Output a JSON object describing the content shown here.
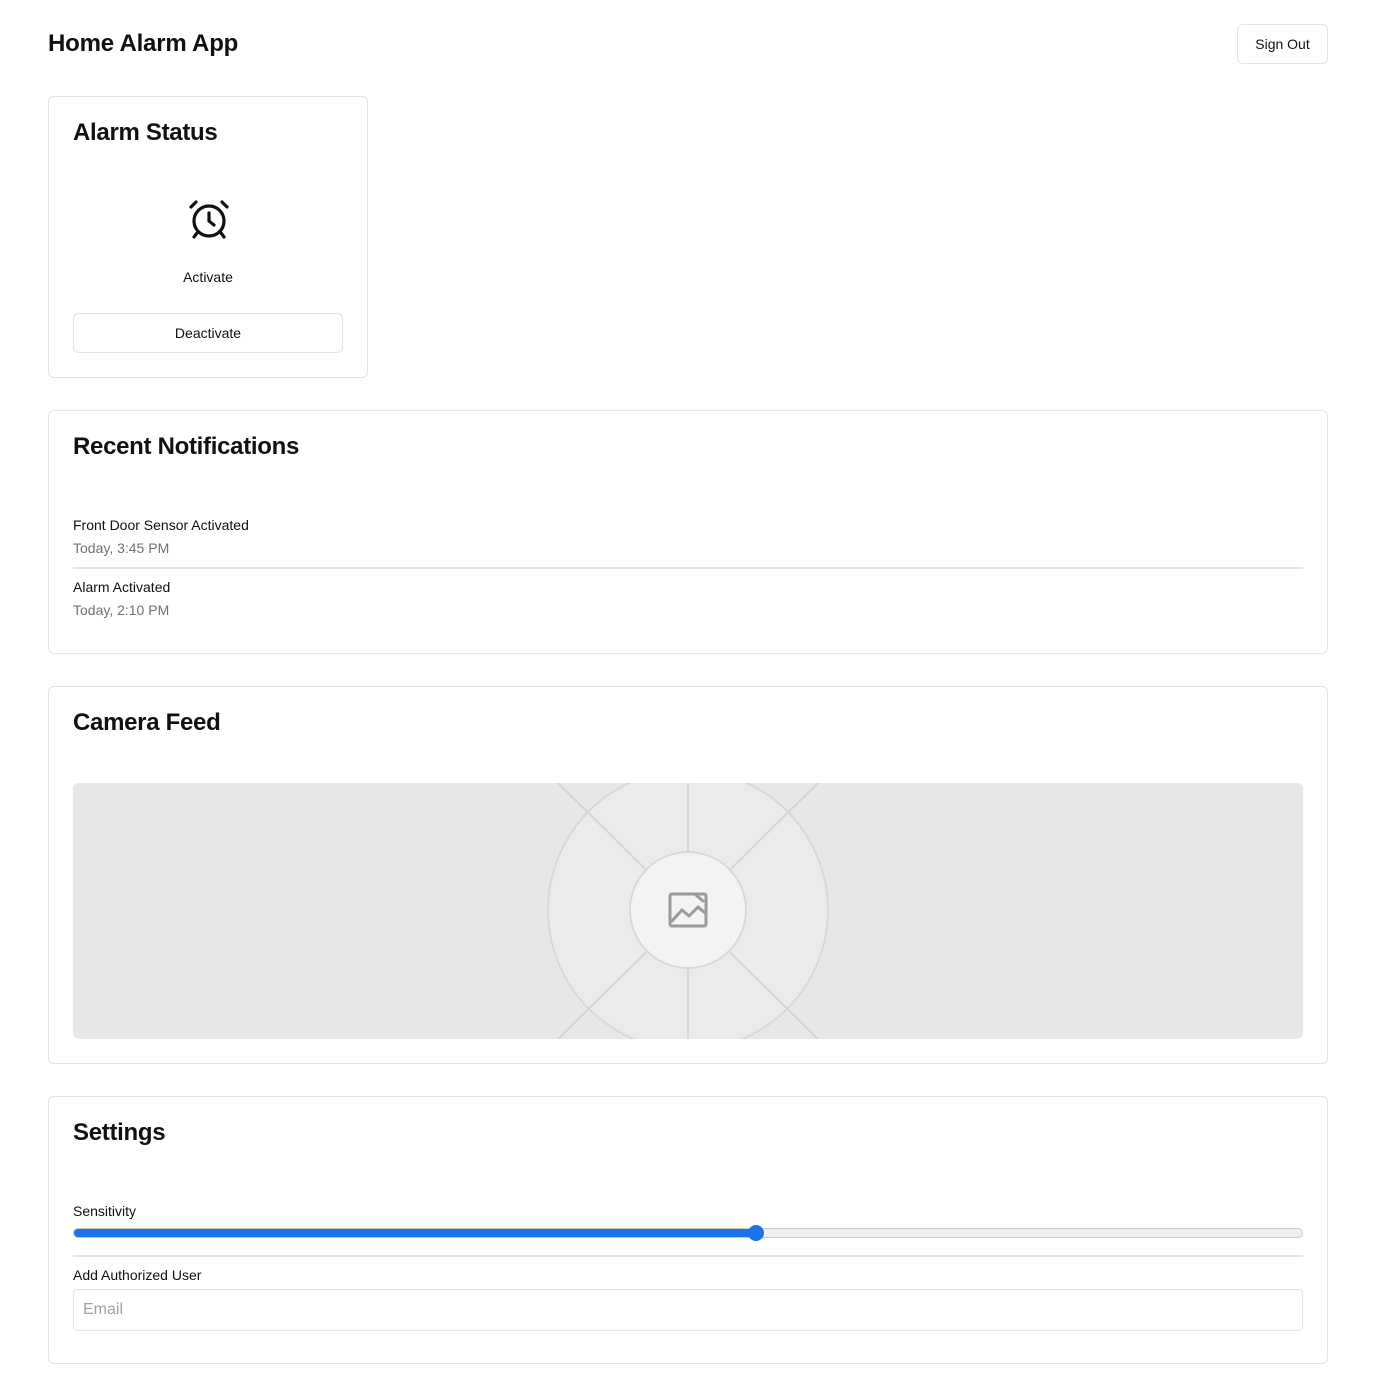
{
  "header": {
    "title": "Home Alarm App",
    "sign_out_label": "Sign Out"
  },
  "alarm": {
    "title": "Alarm Status",
    "icon": "alarm-clock-icon",
    "state_label": "Activate",
    "deactivate_label": "Deactivate"
  },
  "notifications": {
    "title": "Recent Notifications",
    "items": [
      {
        "title": "Front Door Sensor Activated",
        "time": "Today, 3:45 PM"
      },
      {
        "title": "Alarm Activated",
        "time": "Today, 2:10 PM"
      }
    ]
  },
  "camera": {
    "title": "Camera Feed",
    "placeholder_icon": "image-placeholder-icon"
  },
  "settings": {
    "title": "Settings",
    "sensitivity_label": "Sensitivity",
    "sensitivity_value": 0.555,
    "add_user_label": "Add Authorized User",
    "email_placeholder": "Email",
    "email_value": ""
  },
  "colors": {
    "accent": "#1a73e8",
    "border": "#e4e4e7",
    "muted_text": "#71717a",
    "camera_bg": "#e8e8e8"
  }
}
